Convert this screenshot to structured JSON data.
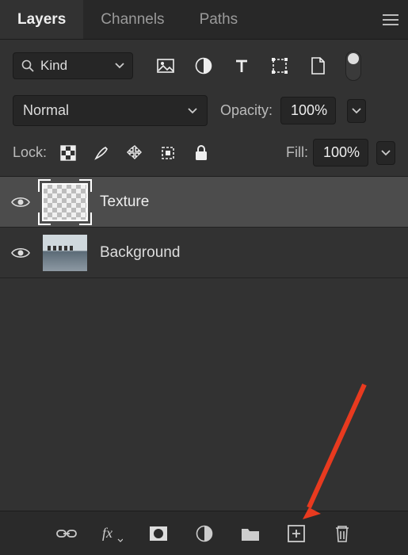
{
  "tabs": {
    "layers": "Layers",
    "channels": "Channels",
    "paths": "Paths"
  },
  "filter": {
    "kind": "Kind"
  },
  "blend": {
    "mode": "Normal",
    "opacity_label": "Opacity:",
    "opacity": "100%"
  },
  "lock": {
    "label": "Lock:",
    "fill_label": "Fill:",
    "fill": "100%"
  },
  "layers": [
    {
      "name": "Texture"
    },
    {
      "name": "Background"
    }
  ]
}
